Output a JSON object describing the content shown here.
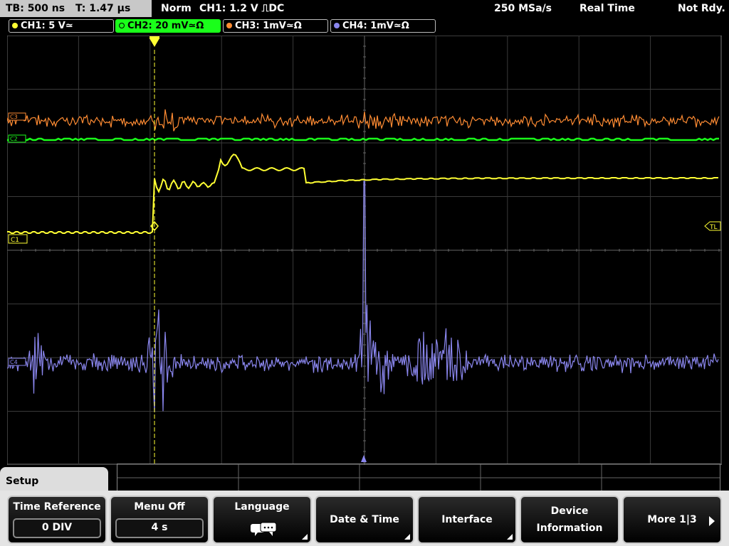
{
  "header": {
    "tb": "TB: 500 ns",
    "t": "T: 1.47 µs",
    "mode": "Norm",
    "trigger": "CH1: 1.2 V ⎍DC",
    "sample_rate": "250 MSa/s",
    "acq": "Real Time",
    "status": "Not Rdy."
  },
  "channels": [
    {
      "label": "CH1: 5 V≃",
      "color": "#ffff33",
      "active": false
    },
    {
      "label": "CH2: 20 mV≃Ω",
      "color": "#1aff1a",
      "active": true
    },
    {
      "label": "CH3: 1mV≃Ω",
      "color": "#ff8c33",
      "active": false
    },
    {
      "label": "CH4: 1mV≃Ω",
      "color": "#8a86ee",
      "active": false
    }
  ],
  "markers": {
    "c1": "C1",
    "tl": "TL",
    "c2": "C2",
    "c3": "C3",
    "c4": "C4"
  },
  "colors": {
    "ch1": "#ffff33",
    "ch2": "#1aff1a",
    "ch3": "#ff8c33",
    "ch4": "#8a86ee",
    "grid": "#444444"
  },
  "menu": {
    "title": "Setup",
    "softkeys": [
      {
        "label": "Time Reference",
        "value": "0 DIV"
      },
      {
        "label": "Menu Off",
        "value": "4 s"
      },
      {
        "label": "Language",
        "icon": "speech-bubble-icon"
      },
      {
        "label": "Date & Time"
      },
      {
        "label": "Interface"
      },
      {
        "label": "Device",
        "label2": "Information"
      },
      {
        "label": "More 1|3"
      }
    ]
  }
}
